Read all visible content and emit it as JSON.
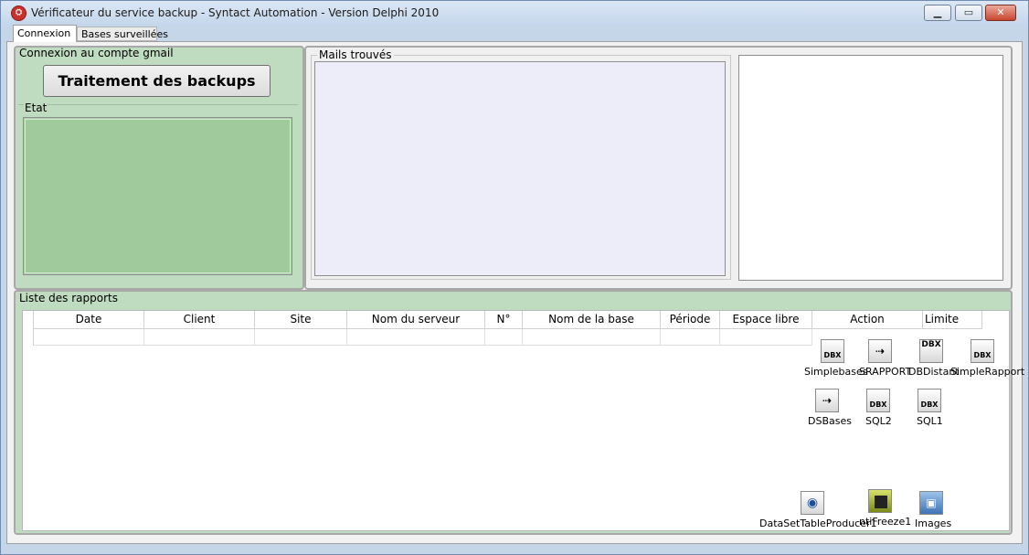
{
  "window": {
    "title": "Vérificateur du service backup - Syntact Automation - Version Delphi 2010",
    "icon": "app-icon",
    "controls": {
      "minimize": "_",
      "maximize": "□",
      "close": "X"
    }
  },
  "tabs": [
    {
      "label": "Connexion",
      "active": true
    },
    {
      "label": "Bases surveillées",
      "active": false
    }
  ],
  "gmail_panel": {
    "label": "Connexion au compte gmail",
    "button_label": "Traitement des backups",
    "etat_label": "Etat"
  },
  "mails_panel": {
    "label": "Mails trouvés"
  },
  "rapports_panel": {
    "label": "Liste des rapports",
    "columns": [
      "Date",
      "Client",
      "Site",
      "Nom du serveur",
      "N°",
      "Nom de la base",
      "Période",
      "Espace libre",
      "Action",
      "Limite"
    ]
  },
  "components": [
    {
      "label": "Simplebases",
      "icon": "dbx-table-icon",
      "glyph": "DBX"
    },
    {
      "label": "SRAPPORT",
      "icon": "dataset-provider-icon",
      "glyph": ""
    },
    {
      "label": "DBDistant",
      "icon": "dbx-connection-icon",
      "glyph": "DBX"
    },
    {
      "label": "SimpleRapport",
      "icon": "dbx-table-icon",
      "glyph": "DBX"
    },
    {
      "label": "DSBases",
      "icon": "dataset-provider-icon",
      "glyph": ""
    },
    {
      "label": "SQL2",
      "icon": "dbx-query-icon",
      "glyph": "DBX"
    },
    {
      "label": "SQL1",
      "icon": "dbx-query-icon",
      "glyph": "DBX"
    },
    {
      "label": "DataSetTableProducer1",
      "icon": "web-producer-icon",
      "glyph": ""
    },
    {
      "label": "ntiFreeze1",
      "icon": "antifreeze-icon",
      "glyph": ""
    },
    {
      "label": "Images",
      "icon": "image-list-icon",
      "glyph": ""
    }
  ],
  "colors": {
    "panel_green": "#c0dcc0",
    "etat_green": "#a0ca9c",
    "mails_list_bg": "#ecedf8",
    "title_bar": "#c4d6eb",
    "close_button": "#c9452f"
  }
}
